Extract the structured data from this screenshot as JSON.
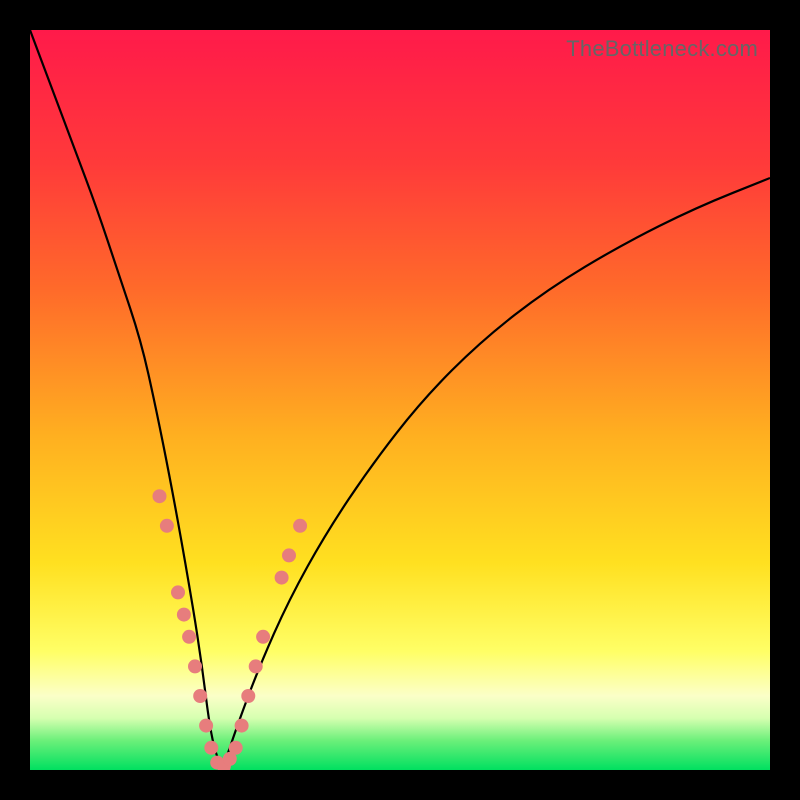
{
  "watermark": "TheBottleneck.com",
  "chart_data": {
    "type": "line",
    "title": "",
    "xlabel": "",
    "ylabel": "",
    "xlim": [
      0,
      100
    ],
    "ylim": [
      0,
      100
    ],
    "gradient_stops": [
      {
        "offset": 0,
        "color": "#ff1a4a"
      },
      {
        "offset": 18,
        "color": "#ff3a3a"
      },
      {
        "offset": 35,
        "color": "#ff6a2a"
      },
      {
        "offset": 55,
        "color": "#ffb020"
      },
      {
        "offset": 72,
        "color": "#ffe020"
      },
      {
        "offset": 84,
        "color": "#ffff66"
      },
      {
        "offset": 90,
        "color": "#fbffc8"
      },
      {
        "offset": 93,
        "color": "#d6ffb0"
      },
      {
        "offset": 96,
        "color": "#6cf07a"
      },
      {
        "offset": 100,
        "color": "#00e060"
      }
    ],
    "series": [
      {
        "name": "bottleneck-curve",
        "color": "#000000",
        "x": [
          0,
          3,
          6,
          9,
          12,
          15,
          17,
          19,
          21,
          23,
          24.5,
          26,
          28,
          31,
          35,
          40,
          46,
          53,
          61,
          70,
          80,
          90,
          100
        ],
        "y": [
          100,
          92,
          84,
          76,
          67,
          58,
          49,
          39,
          28,
          16,
          4,
          0,
          6,
          14,
          23,
          32,
          41,
          50,
          58,
          65,
          71,
          76,
          80
        ]
      }
    ],
    "scatter": {
      "name": "sample-points",
      "color": "#e77d7d",
      "radius": 7,
      "points": [
        {
          "x": 17.5,
          "y": 37
        },
        {
          "x": 18.5,
          "y": 33
        },
        {
          "x": 20.0,
          "y": 24
        },
        {
          "x": 20.8,
          "y": 21
        },
        {
          "x": 21.5,
          "y": 18
        },
        {
          "x": 22.3,
          "y": 14
        },
        {
          "x": 23.0,
          "y": 10
        },
        {
          "x": 23.8,
          "y": 6
        },
        {
          "x": 24.5,
          "y": 3
        },
        {
          "x": 25.3,
          "y": 1
        },
        {
          "x": 26.2,
          "y": 0.5
        },
        {
          "x": 27.0,
          "y": 1.5
        },
        {
          "x": 27.8,
          "y": 3
        },
        {
          "x": 28.6,
          "y": 6
        },
        {
          "x": 29.5,
          "y": 10
        },
        {
          "x": 30.5,
          "y": 14
        },
        {
          "x": 31.5,
          "y": 18
        },
        {
          "x": 34.0,
          "y": 26
        },
        {
          "x": 36.5,
          "y": 33
        },
        {
          "x": 35.0,
          "y": 29
        }
      ]
    }
  }
}
